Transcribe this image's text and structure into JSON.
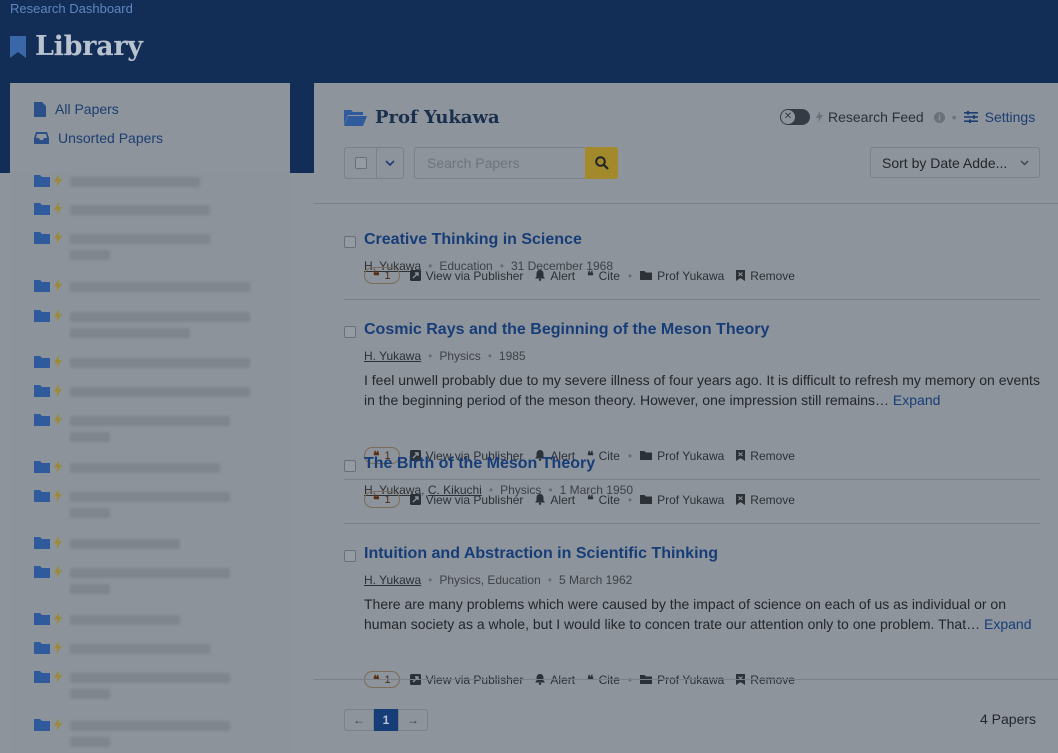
{
  "header": {
    "breadcrumb": "Research Dashboard",
    "title": "Library"
  },
  "sidebar": {
    "all_papers": "All Papers",
    "unsorted_papers": "Unsorted Papers"
  },
  "collection": {
    "name": "Prof Yukawa",
    "feed_label": "Research Feed",
    "settings_label": "Settings"
  },
  "toolbar": {
    "search_placeholder": "Search Papers",
    "sort_label": "Sort by Date Adde..."
  },
  "papers": [
    {
      "title": "Creative Thinking in Science",
      "authors": [
        "H. Yukawa"
      ],
      "field": "Education",
      "date": "31 December 1968",
      "abstract": "",
      "citations": "1"
    },
    {
      "title": "Cosmic Rays and the Beginning of the Meson Theory",
      "authors": [
        "H. Yukawa"
      ],
      "field": "Physics",
      "date": "1985",
      "abstract": "I feel unwell probably due to my severe illness of four years ago. It is difficult to refresh my memory on events in the beginning period of the meson theory. However, one impression still remains…",
      "citations": "1"
    },
    {
      "title": "The Birth of the Meson Theory",
      "authors": [
        "H. Yukawa",
        "C. Kikuchi"
      ],
      "field": "Physics",
      "date": "1 March 1950",
      "abstract": "",
      "citations": "1"
    },
    {
      "title": "Intuition and Abstraction in Scientific Thinking",
      "authors": [
        "H. Yukawa"
      ],
      "field": "Physics, Education",
      "date": "5 March 1962",
      "abstract": "There are many problems which were caused by the impact of science on each of us as individual or on human society as a whole, but I would like to concen trate our attention only to one problem. That…",
      "citations": "1"
    }
  ],
  "actions": {
    "view": "View via Publisher",
    "alert": "Alert",
    "cite": "Cite",
    "folder": "Prof Yukawa",
    "remove": "Remove",
    "expand": "Expand"
  },
  "pagination": {
    "prev": "←",
    "current": "1",
    "next": "→",
    "total": "4 Papers"
  },
  "colors": {
    "accent": "#163d78",
    "header_bg": "#132e56",
    "search_button": "#a28a2c"
  }
}
